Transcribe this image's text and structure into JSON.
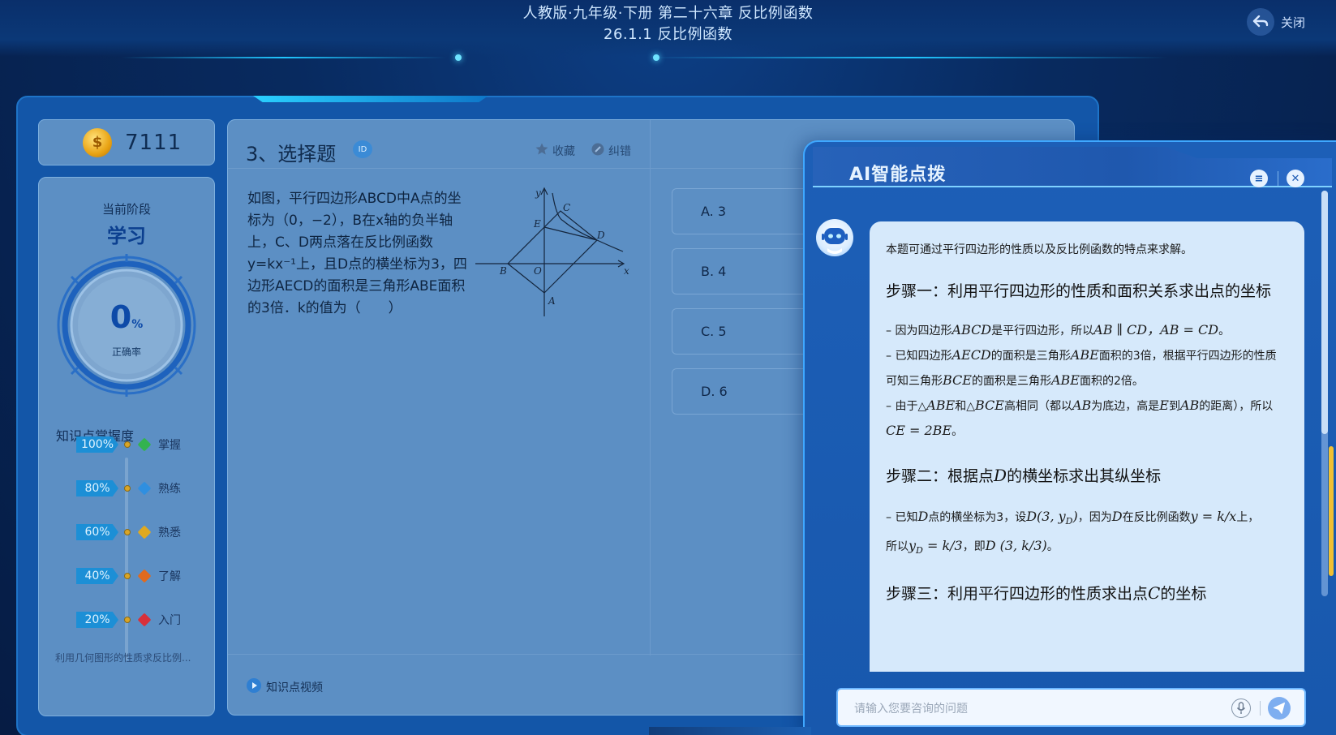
{
  "header": {
    "title_line1": "人教版·九年级·下册  第二十六章 反比例函数",
    "title_line2": "26.1.1 反比例函数",
    "close_label": "关闭"
  },
  "coins": {
    "value": "7111"
  },
  "stage": {
    "label": "当前阶段",
    "value": "学习",
    "accuracy_value": "0",
    "accuracy_unit": "%",
    "accuracy_label": "正确率"
  },
  "mastery": {
    "title": "知识点掌握度",
    "levels": [
      {
        "percent": "100%",
        "label": "掌握",
        "color": "#33b34f"
      },
      {
        "percent": "80%",
        "label": "熟练",
        "color": "#2f8fe0"
      },
      {
        "percent": "60%",
        "label": "熟悉",
        "color": "#e0a920"
      },
      {
        "percent": "40%",
        "label": "了解",
        "color": "#e06a1e"
      },
      {
        "percent": "20%",
        "label": "入门",
        "color": "#d8303a"
      }
    ],
    "footer": "利用几何图形的性质求反比例..."
  },
  "question": {
    "title": "3、选择题",
    "id_badge": "ID",
    "favorite_label": "收藏",
    "report_label": "纠错",
    "text": "如图，平行四边形ABCD中A点的坐标为（0，−2），B在x轴的负半轴上，C、D两点落在反比例函数y=kx⁻¹上，且D点的横坐标为3，四边形AECD的面积是三角形ABE面积的3倍．k的值为（　　）",
    "figure_labels": {
      "y": "y",
      "x": "x",
      "c": "C",
      "e": "E",
      "d": "D",
      "b": "B",
      "o": "O",
      "a": "A"
    },
    "options": [
      {
        "label": "A.  3"
      },
      {
        "label": "B.  4"
      },
      {
        "label": "C.  5"
      },
      {
        "label": "D.  6"
      }
    ],
    "video_label": "知识点视频"
  },
  "ai": {
    "title": "AI智能点拨",
    "intro": "本题可通过平行四边形的性质以及反比例函数的特点来求解。",
    "step1_title": "步骤一：利用平行四边形的性质和面积关系求出点的坐标",
    "step1_l1a": "– 因为四边形",
    "step1_l1m1": "ABCD",
    "step1_l1b": "是平行四边形，所以",
    "step1_l1m2": "AB ∥ CD，AB = CD",
    "step1_l1c": "。",
    "step1_l2a": "– 已知四边形",
    "step1_l2m1": "AECD",
    "step1_l2b": "的面积是三角形",
    "step1_l2m2": "ABE",
    "step1_l2c": "面积的3倍，根据平行四边形的性质可知三角形",
    "step1_l2m3": "BCE",
    "step1_l2d": "的面积是三角形",
    "step1_l2m4": "ABE",
    "step1_l2e": "面积的2倍。",
    "step1_l3a": "– 由于△",
    "step1_l3m1": "ABE",
    "step1_l3b": "和△",
    "step1_l3m2": "BCE",
    "step1_l3c": "高相同（都以",
    "step1_l3m3": "AB",
    "step1_l3d": "为底边，高是",
    "step1_l3m4": "E",
    "step1_l3e": "到",
    "step1_l3m5": "AB",
    "step1_l3f": "的距离），所以",
    "step1_l3m6": "CE = 2BE",
    "step1_l3g": "。",
    "step2_title_a": "步骤二：根据点",
    "step2_title_m": "D",
    "step2_title_b": "的横坐标求出其纵坐标",
    "step2_l1a": "– 已知",
    "step2_l1m1": "D",
    "step2_l1b": "点的横坐标为3，设",
    "step2_l1m2": "D(3, y",
    "step2_l1sub": "D",
    "step2_l1m3": ")",
    "step2_l1c": "，因为",
    "step2_l1m4": "D",
    "step2_l1d": "在反比例函数",
    "step2_l1m5": "y = k/x",
    "step2_l1e": "上，",
    "step2_l2a": "所以",
    "step2_l2m1": "y",
    "step2_l2sub": "D",
    "step2_l2m2": " = k/3",
    "step2_l2b": "，即",
    "step2_l2m3": "D (3, k/3)",
    "step2_l2c": "。",
    "step3_title_a": "步骤三：利用平行四边形的性质求出点",
    "step3_title_m": "C",
    "step3_title_b": "的坐标",
    "input_placeholder": "请输入您要咨询的问题"
  }
}
